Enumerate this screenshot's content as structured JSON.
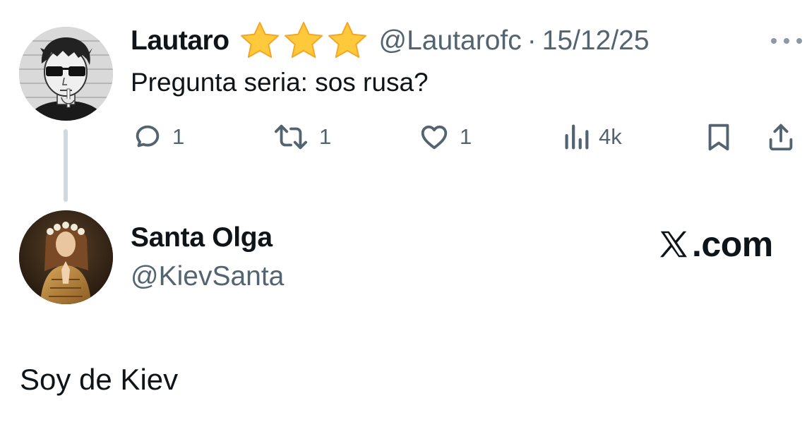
{
  "tweet": {
    "display_name": "Lautaro",
    "badges": [
      "star-emoji",
      "star-emoji",
      "star-emoji"
    ],
    "handle": "@Lautarofc",
    "separator": "·",
    "date": "15/12/25",
    "text": "Pregunta seria: sos rusa?",
    "actions": {
      "reply_count": "1",
      "retweet_count": "1",
      "like_count": "1",
      "view_count": "4k"
    }
  },
  "reply": {
    "display_name": "Santa Olga",
    "handle": "@KievSanta",
    "brand": ".com",
    "text": "Soy de Kiev"
  },
  "colors": {
    "text": "#0f1419",
    "secondary": "#536471",
    "thread_line": "#cfd9de",
    "star": "#ffc93c"
  },
  "icons": [
    "more-icon",
    "reply-icon",
    "retweet-icon",
    "like-icon",
    "views-icon",
    "bookmark-icon",
    "share-icon",
    "x-logo-icon"
  ]
}
